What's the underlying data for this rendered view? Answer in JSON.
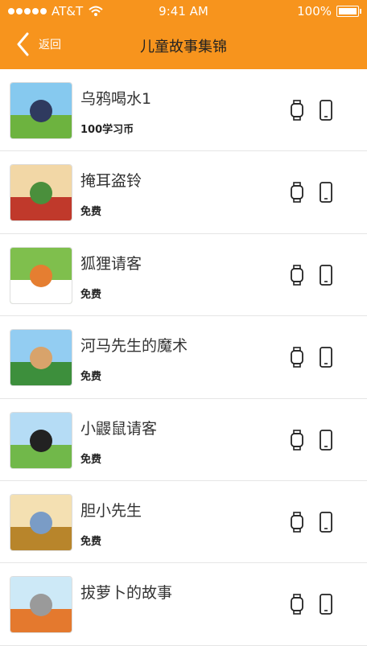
{
  "status_bar": {
    "carrier": "AT&T",
    "time": "9:41 AM",
    "battery": "100%"
  },
  "nav": {
    "back_label": "返回",
    "title": "儿童故事集锦"
  },
  "stories": [
    {
      "title": "乌鸦喝水1",
      "price": "100学习币",
      "thumb_colors": [
        "#86c9ef",
        "#6db33f",
        "#2f3a5f"
      ]
    },
    {
      "title": "掩耳盗铃",
      "price": "免费",
      "thumb_colors": [
        "#f2d7a6",
        "#c0392b",
        "#4a8f3c"
      ]
    },
    {
      "title": "狐狸请客",
      "price": "免费",
      "thumb_colors": [
        "#7fbf4d",
        "#ffffff",
        "#e57e31"
      ]
    },
    {
      "title": "河马先生的魔术",
      "price": "免费",
      "thumb_colors": [
        "#93cdf2",
        "#3d8f3c",
        "#d8a36b"
      ]
    },
    {
      "title": "小鼹鼠请客",
      "price": "免费",
      "thumb_colors": [
        "#b5dcf5",
        "#71b84a",
        "#222222"
      ]
    },
    {
      "title": "胆小先生",
      "price": "免费",
      "thumb_colors": [
        "#f4e0b2",
        "#b8852b",
        "#7a9cc6"
      ]
    },
    {
      "title": "拔萝卜的故事",
      "price": "",
      "thumb_colors": [
        "#cde9f7",
        "#e4792e",
        "#9a9a9a"
      ]
    }
  ],
  "icons": {
    "watch": "watch-icon",
    "phone": "phone-icon",
    "back": "chevron-left-icon"
  },
  "colors": {
    "header": "#f7941d"
  }
}
